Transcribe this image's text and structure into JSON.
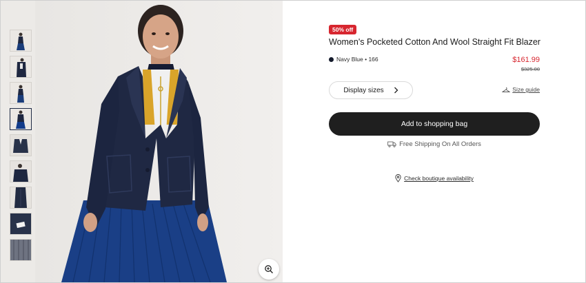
{
  "gallery": {
    "thumbnails": [
      {
        "label": "view 1"
      },
      {
        "label": "view 2"
      },
      {
        "label": "view 3"
      },
      {
        "label": "view 4",
        "active": true
      },
      {
        "label": "view 5"
      },
      {
        "label": "view 6"
      },
      {
        "label": "view 7"
      },
      {
        "label": "view 8"
      },
      {
        "label": "view 9"
      }
    ],
    "zoom_icon": "zoom-in-icon"
  },
  "product": {
    "badge": "50% off",
    "title": "Women's Pocketed Cotton And Wool Straight Fit Blazer",
    "color_name": "Navy Blue • 166",
    "price": "$161.99",
    "old_price": "$325.00"
  },
  "actions": {
    "sizes_label": "Display sizes",
    "size_guide_label": "Size guide",
    "add_to_bag_label": "Add to shopping bag",
    "shipping_text": "Free Shipping On All Orders",
    "boutique_text": "Check boutique availability"
  },
  "colors": {
    "sale_red": "#d7262f",
    "button_dark": "#1f1f1f",
    "navy": "#141a2b",
    "background_grey": "#eceae7"
  }
}
